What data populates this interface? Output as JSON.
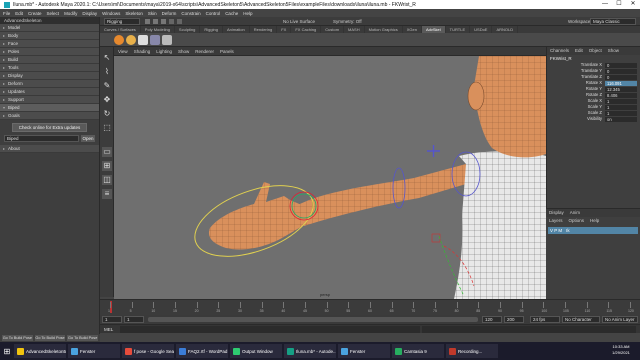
{
  "window": {
    "title": "Iluna.mb* - Autodesk Maya 2020.1: C:\\Users\\ml\\Documents\\maya\\2019-x64\\scripts\\AdvancedSkeleton5\\AdvancedSkeleton5Files\\exampleFiles\\downloads\\iluna\\iluna.mb - FKWrist_R",
    "minimize": "—",
    "maximize": "☐",
    "close": "✕"
  },
  "menu": [
    "File",
    "Edit",
    "Create",
    "Select",
    "Modify",
    "Display",
    "Windows",
    "Skeleton",
    "Skin",
    "Deform",
    "Constrain",
    "Control",
    "Cache",
    "Help"
  ],
  "status": {
    "mode": "Rigging",
    "no_live": "No Live Surface",
    "symmetry": "Symmetry: Off",
    "workspace_label": "Workspace:",
    "workspace": "Maya Classic"
  },
  "shelf_tabs": [
    "Curves / Surfaces",
    "Poly Modeling",
    "Sculpting",
    "Rigging",
    "Animation",
    "Rendering",
    "FX",
    "FX Caching",
    "Custom",
    "MASH",
    "Motion Graphics",
    "XGen",
    "AdvSkel",
    "TURTLE",
    "USDoE",
    "ARNOLD"
  ],
  "shelf_active": "AdvSkel",
  "left_panel": {
    "title": "AdvancedSkeleton",
    "items": [
      "Model",
      "Body",
      "Face",
      "Poles",
      "Build",
      "Tools",
      "Display",
      "Deform",
      "Updates",
      "Support",
      "Biped",
      "Goals"
    ],
    "open_index": 10,
    "button": "Check online for Extra updates",
    "select_value": "Biped",
    "open_label": "Open",
    "about": "About"
  },
  "viewport_menu": [
    "View",
    "Shading",
    "Lighting",
    "Show",
    "Renderer",
    "Panels"
  ],
  "viewport_camera": "persp",
  "channel_box": {
    "tabs": [
      "Channels",
      "Edit",
      "Object",
      "Show"
    ],
    "node": "FKWrist_R",
    "attrs": [
      {
        "name": "Translate X",
        "value": "0"
      },
      {
        "name": "Translate Y",
        "value": "0"
      },
      {
        "name": "Translate Z",
        "value": "0"
      },
      {
        "name": "Rotate X",
        "value": "116.091",
        "selected": true
      },
      {
        "name": "Rotate Y",
        "value": "12.345"
      },
      {
        "name": "Rotate Z",
        "value": "8.406"
      },
      {
        "name": "Scale X",
        "value": "1"
      },
      {
        "name": "Scale Y",
        "value": "1"
      },
      {
        "name": "Scale Z",
        "value": "1"
      },
      {
        "name": "Visibility",
        "value": "on"
      }
    ]
  },
  "layers": {
    "tabs": [
      "Display",
      "Anim"
    ],
    "menu": [
      "Layers",
      "Options",
      "Help"
    ],
    "row_label": "V  P  M",
    "layer_name": "Ik"
  },
  "timeline": {
    "ticks": [
      "1",
      "5",
      "10",
      "15",
      "20",
      "25",
      "30",
      "35",
      "40",
      "45",
      "50",
      "55",
      "60",
      "65",
      "70",
      "75",
      "80",
      "85",
      "90",
      "95",
      "100",
      "105",
      "110",
      "115",
      "120"
    ],
    "current": "1"
  },
  "range": {
    "start": "1",
    "end": "120",
    "start2": "1",
    "end2": "200",
    "fps": "24 fps",
    "anim_layer": "No Anim Layer",
    "char": "No Character Set"
  },
  "mel": {
    "label": "MEL"
  },
  "left_bottom": [
    "Go To Build Pose",
    "Go To Build Pose",
    "Go To Build Pose"
  ],
  "taskbar": [
    {
      "label": "AdvancedSkeleton5",
      "color": "#f1c40f"
    },
    {
      "label": "Fenster",
      "color": "#4aa3df"
    },
    {
      "label": "f pose - Google Sea...",
      "color": "#e74c3c"
    },
    {
      "label": "FAQ2.rtf - WordPad",
      "color": "#3b7dd8"
    },
    {
      "label": "Output Window",
      "color": "#2ecc71"
    },
    {
      "label": "Iluna.mb* - Autode...",
      "color": "#16a085"
    },
    {
      "label": "Fenster",
      "color": "#4aa3df"
    },
    {
      "label": "Camtasia 9",
      "color": "#27ae60"
    },
    {
      "label": "Recording...",
      "color": "#c0392b"
    }
  ],
  "clock": {
    "time": "10:33 AM",
    "date": "1/29/2021"
  },
  "colors": {
    "skin": "#d9905c",
    "accent": "#5285a6"
  }
}
